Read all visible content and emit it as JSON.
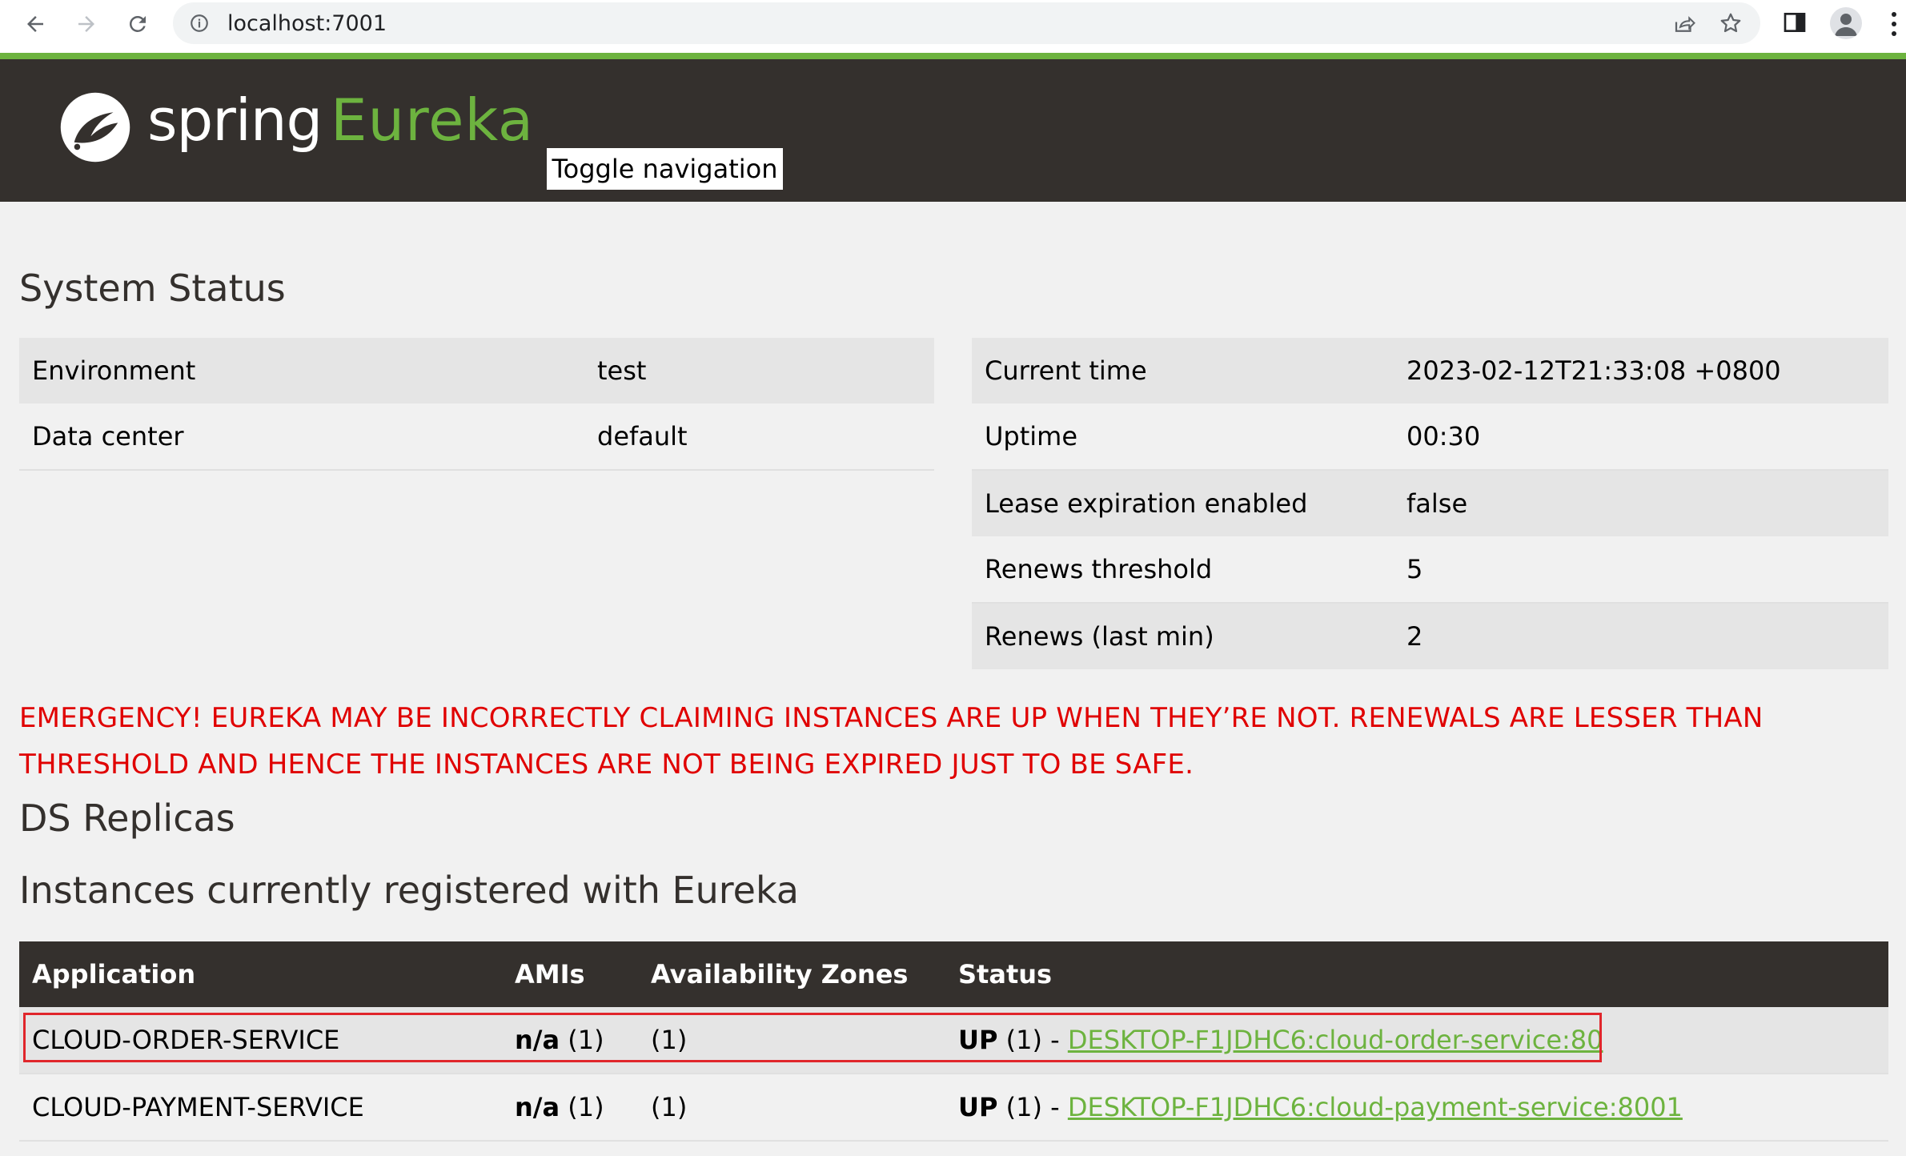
{
  "browser": {
    "url": "localhost:7001",
    "icons": [
      "back-arrow-icon",
      "forward-arrow-icon",
      "reload-icon",
      "info-icon",
      "share-icon",
      "star-icon",
      "side-panel-icon",
      "profile-icon",
      "more-menu-icon"
    ]
  },
  "header": {
    "brand_spring": "spring",
    "brand_eureka": "Eureka",
    "toggle_label": "Toggle navigation",
    "colors": {
      "background": "#34302d",
      "accent": "#6db33f"
    }
  },
  "system_status": {
    "title": "System Status",
    "left": [
      {
        "key": "Environment",
        "value": "test"
      },
      {
        "key": "Data center",
        "value": "default"
      }
    ],
    "right": [
      {
        "key": "Current time",
        "value": "2023-02-12T21:33:08 +0800"
      },
      {
        "key": "Uptime",
        "value": "00:30"
      },
      {
        "key": "Lease expiration enabled",
        "value": "false"
      },
      {
        "key": "Renews threshold",
        "value": "5"
      },
      {
        "key": "Renews (last min)",
        "value": "2"
      }
    ]
  },
  "emergency": {
    "text": "EMERGENCY! EUREKA MAY BE INCORRECTLY CLAIMING INSTANCES ARE UP WHEN THEY’RE NOT. RENEWALS ARE LESSER THAN THRESHOLD AND HENCE THE INSTANCES ARE NOT BEING EXPIRED JUST TO BE SAFE.",
    "color": "#e00000"
  },
  "ds_replicas": {
    "title": "DS Replicas"
  },
  "instances": {
    "title": "Instances currently registered with Eureka",
    "columns": [
      "Application",
      "AMIs",
      "Availability Zones",
      "Status"
    ],
    "rows": [
      {
        "application": "CLOUD-ORDER-SERVICE",
        "amis_label": "n/a",
        "amis_count": "(1)",
        "zones": "(1)",
        "status_prefix": "UP",
        "status_count": "(1) -",
        "link": "DESKTOP-F1JDHC6:cloud-order-service:80"
      },
      {
        "application": "CLOUD-PAYMENT-SERVICE",
        "amis_label": "n/a",
        "amis_count": "(1)",
        "zones": "(1)",
        "status_prefix": "UP",
        "status_count": "(1) -",
        "link": "DESKTOP-F1JDHC6:cloud-payment-service:8001"
      }
    ],
    "highlight_color": "#e0262b"
  }
}
